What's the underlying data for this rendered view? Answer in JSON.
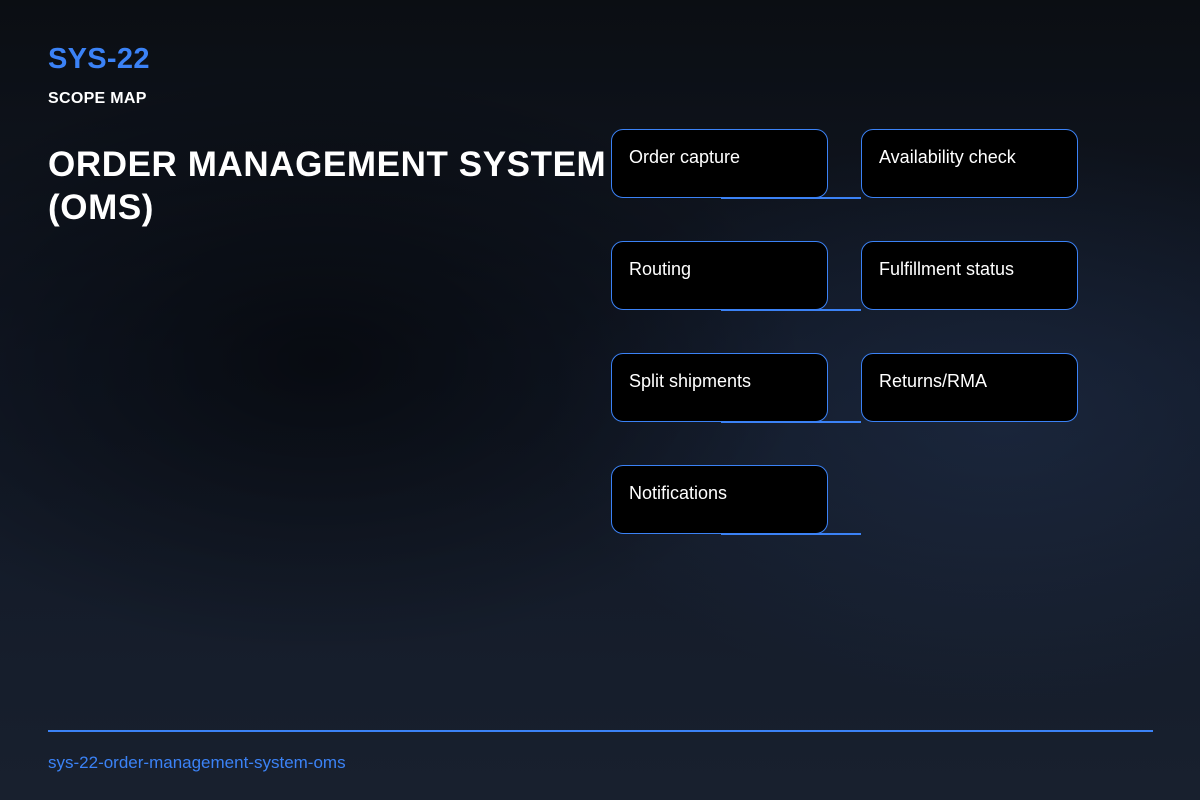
{
  "header": {
    "code": "SYS-22",
    "subtitle": "SCOPE MAP",
    "title": "ORDER MANAGEMENT SYSTEM (OMS)"
  },
  "scope_items": [
    "Order capture",
    "Availability check",
    "Routing",
    "Fulfillment status",
    "Split shipments",
    "Returns/RMA",
    "Notifications"
  ],
  "footer": {
    "slug": "sys-22-order-management-system-oms"
  },
  "colors": {
    "accent": "#3b82f6",
    "node_fill": "#000000",
    "text": "#ffffff"
  }
}
